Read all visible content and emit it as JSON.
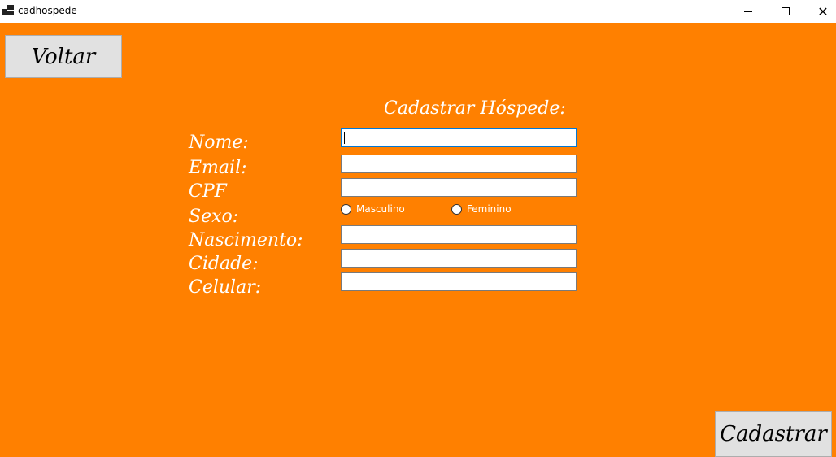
{
  "window": {
    "title": "cadhospede",
    "icon": "app-window-icon",
    "controls": [
      "minimize-icon",
      "maximize-icon",
      "close-icon"
    ],
    "close_glyph": "✕"
  },
  "colors": {
    "background": "#ff8000",
    "label_text": "#ffffff",
    "button_bg": "#e1e1e1"
  },
  "buttons": {
    "back_label": "Voltar",
    "submit_label": "Cadastrar"
  },
  "form": {
    "heading": "Cadastrar Hóspede:",
    "labels": {
      "nome": "Nome:",
      "email": "Email:",
      "cpf": "CPF",
      "sexo": "Sexo:",
      "nascimento": "Nascimento:",
      "cidade": "Cidade:",
      "celular": "Celular:"
    },
    "values": {
      "nome": "",
      "email": "",
      "cpf": "",
      "nascimento": "",
      "cidade": "",
      "celular": ""
    },
    "sexo_options": {
      "masculino": "Masculino",
      "feminino": "Feminino"
    }
  }
}
